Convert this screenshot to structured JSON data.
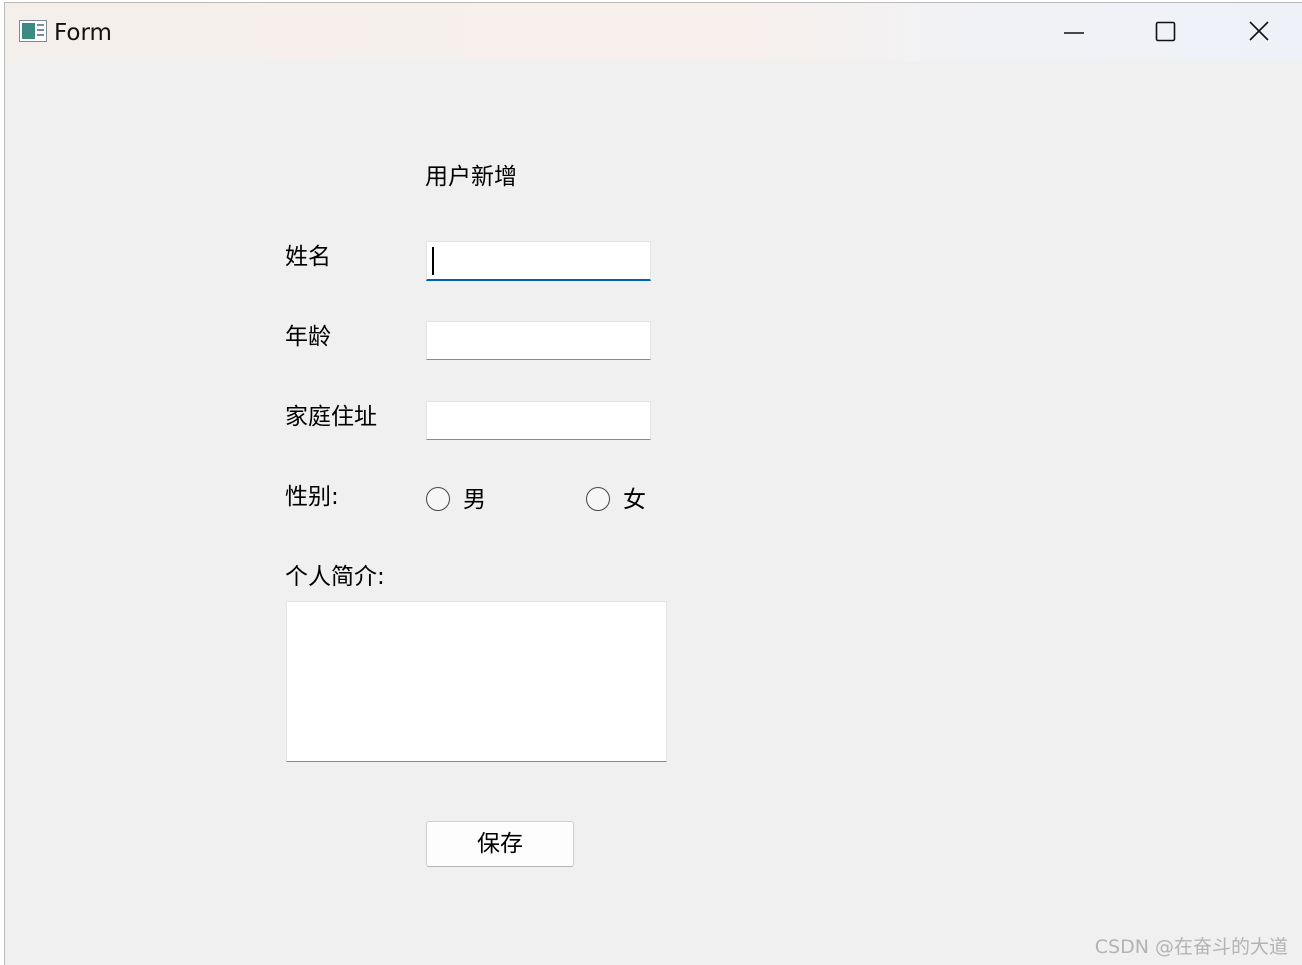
{
  "window": {
    "title": "Form",
    "controls": {
      "minimize": "minimize-icon",
      "maximize": "maximize-icon",
      "close": "close-icon"
    }
  },
  "form": {
    "heading": "用户新增",
    "name_label": "姓名",
    "name_value": "",
    "age_label": "年龄",
    "age_value": "",
    "address_label": "家庭住址",
    "address_value": "",
    "gender_label": "性别:",
    "gender_options": [
      "男",
      "女"
    ],
    "bio_label": "个人简介:",
    "bio_value": "",
    "save_label": "保存"
  },
  "watermark": "CSDN @在奋斗的大道"
}
